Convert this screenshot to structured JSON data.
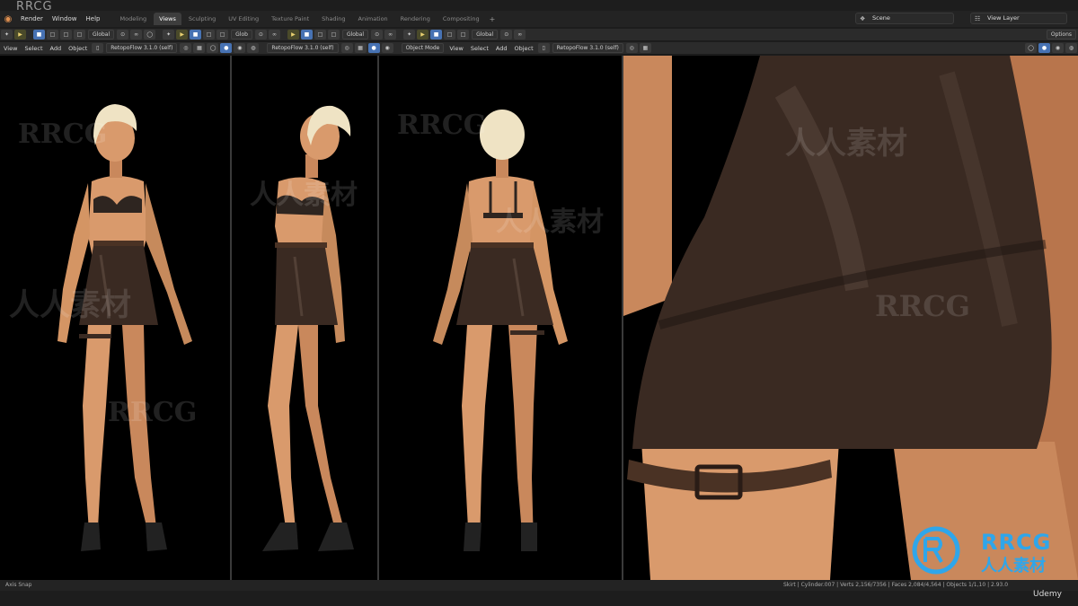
{
  "watermark_top": "RRCG",
  "menu": {
    "items": [
      "Render",
      "Window",
      "Help"
    ]
  },
  "workspaces": [
    "Modeling",
    "Views",
    "Sculpting",
    "UV Editing",
    "Texture Paint",
    "Shading",
    "Animation",
    "Rendering",
    "Compositing"
  ],
  "active_workspace": "Views",
  "scene": {
    "label": "Scene"
  },
  "view_layer": {
    "label": "View Layer"
  },
  "toolbar": {
    "transform_orientation": "Global",
    "snap_target": "Glob",
    "options_label": "Options"
  },
  "viewport_header": {
    "menu": [
      "View",
      "Select",
      "Add",
      "Object"
    ],
    "retopo_label": "RetopoFlow 3.1.0 (self)",
    "mode_label": "Object Mode"
  },
  "status": {
    "left": "Axis Snap",
    "right": "Skirt | Cylinder.007 | Verts 2,156/7356 | Faces 2,084/4,564 | Objects 1/1,10 | 2.93.0"
  },
  "watermarks": [
    "RRCG",
    "人人素材",
    "RRCG",
    "人人素材",
    "RRCG",
    "人人素材"
  ],
  "brand": {
    "name": "RRCG",
    "cn": "人人素材"
  },
  "credit": "Udemy",
  "colors": {
    "skin": "#d99a6c",
    "skin_shadow": "#b8754c",
    "hair": "#efe3c4",
    "leather": "#3a2a22",
    "leather_highlight": "#6a564a",
    "accent_blue": "#4772b3",
    "brand_blue": "#2fa6ea"
  }
}
